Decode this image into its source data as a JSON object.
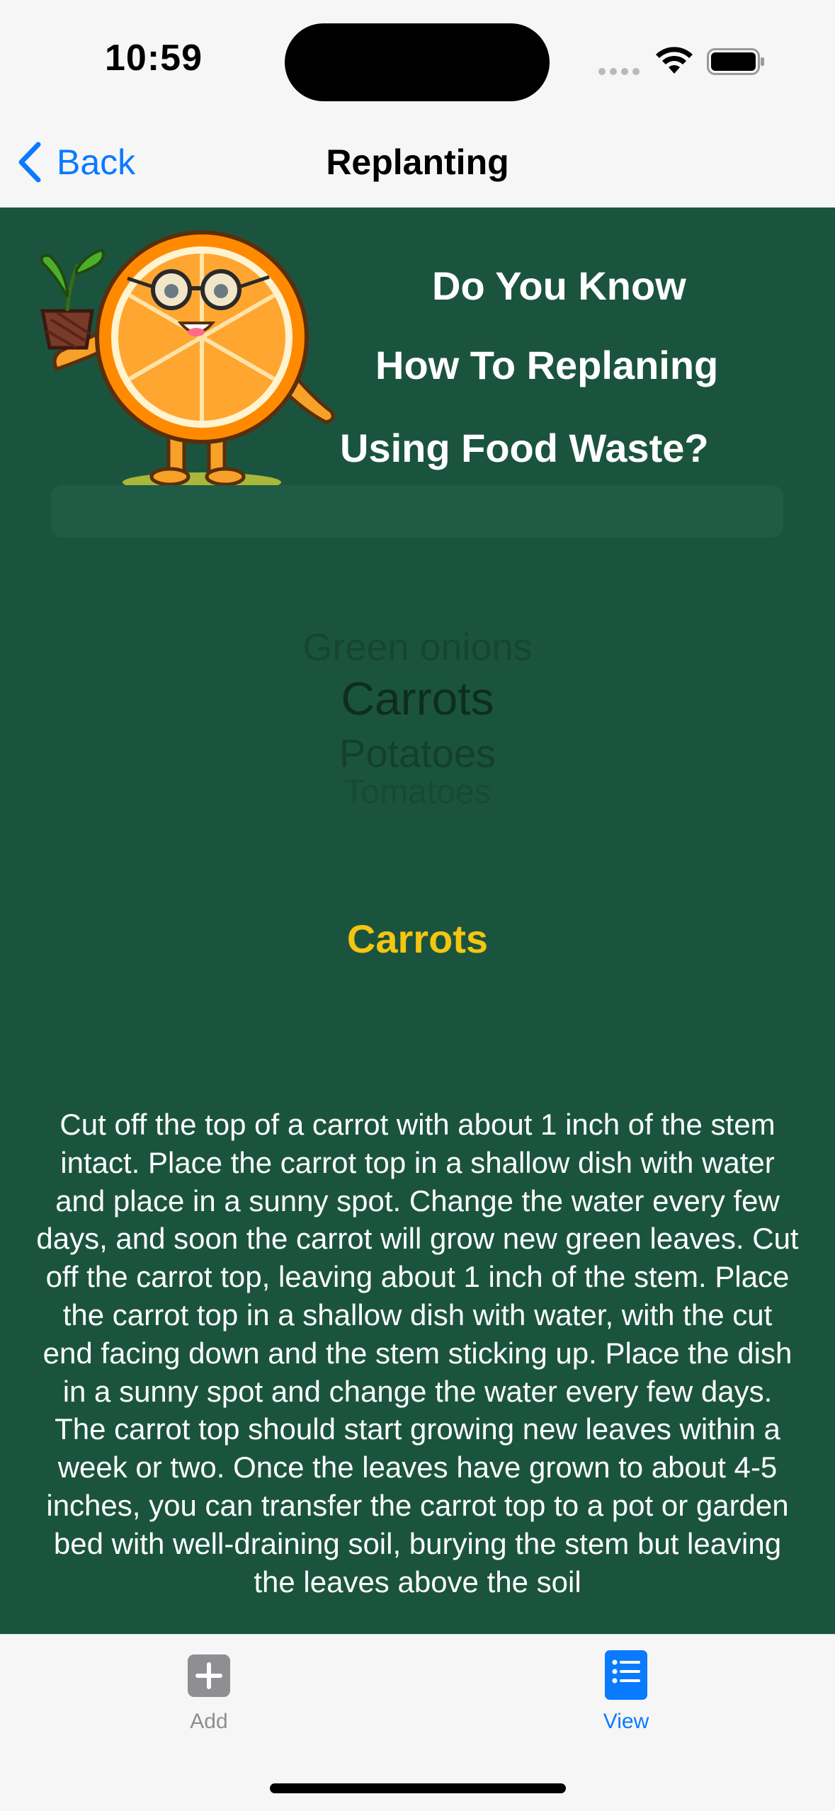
{
  "status_bar": {
    "time": "10:59",
    "icons": [
      "signal-dots-icon",
      "wifi-icon",
      "battery-icon"
    ]
  },
  "nav": {
    "back_label": "Back",
    "title": "Replanting"
  },
  "header": {
    "line1": "Do You Know",
    "line2": "How To Replaning",
    "line3": "Using Food Waste?"
  },
  "picker": {
    "items": [
      "Green onions",
      "Carrots",
      "Potatoes",
      "Tomatoes"
    ],
    "selected": "Carrots"
  },
  "detail": {
    "title": "Carrots",
    "description": "Cut off the top of a carrot with about 1 inch of the stem intact. Place the carrot top in a shallow dish with water and place in a sunny spot. Change the water every few days, and soon the carrot will grow new green leaves. Cut off the carrot top, leaving about 1 inch of the stem. Place the carrot top in a shallow dish with water, with the cut end facing down and the stem sticking up. Place the dish in a sunny spot and change the water every few days. The carrot top should start growing new leaves within a week or two. Once the leaves have grown to about 4-5 inches, you can transfer the carrot top to a pot or garden bed with well-draining soil, burying the stem but leaving the leaves above the soil"
  },
  "tabs": {
    "add_label": "Add",
    "view_label": "View",
    "active": "View"
  },
  "colors": {
    "background": "#1b543e",
    "accent": "#0a7aff",
    "highlight_title": "#f4c511",
    "text": "#ffffff"
  }
}
